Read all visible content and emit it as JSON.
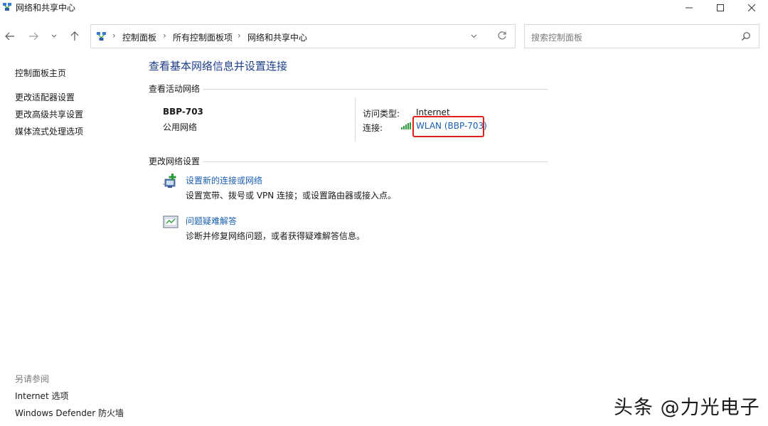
{
  "window": {
    "title": "网络和共享中心"
  },
  "address": {
    "crumbs": [
      "控制面板",
      "所有控制面板项",
      "网络和共享中心"
    ]
  },
  "search": {
    "placeholder": "搜索控制面板"
  },
  "left_pane": {
    "items": [
      "控制面板主页",
      "更改适配器设置",
      "更改高级共享设置",
      "媒体流式处理选项"
    ],
    "see_also_label": "另请参阅",
    "see_also": [
      "Internet 选项",
      "Windows Defender 防火墙"
    ]
  },
  "main": {
    "title": "查看基本网络信息并设置连接",
    "active_section": "查看活动网络",
    "network": {
      "name": "BBP-703",
      "category": "公用网络",
      "access_type_label": "访问类型:",
      "access_type_value": "Internet",
      "connection_label": "连接:",
      "connection_value": "WLAN (BBP-703)"
    },
    "change_section": "更改网络设置",
    "tasks": [
      {
        "link": "设置新的连接或网络",
        "desc": "设置宽带、拨号或 VPN 连接；或设置路由器或接入点。",
        "icon": "new-connection-icon"
      },
      {
        "link": "问题疑难解答",
        "desc": "诊断并修复网络问题，或者获得疑难解答信息。",
        "icon": "troubleshoot-icon"
      }
    ]
  },
  "watermark": "头条 @力光电子",
  "colors": {
    "link": "#1a5fb4",
    "title": "#1e3e8a",
    "highlight": "#e02020"
  }
}
